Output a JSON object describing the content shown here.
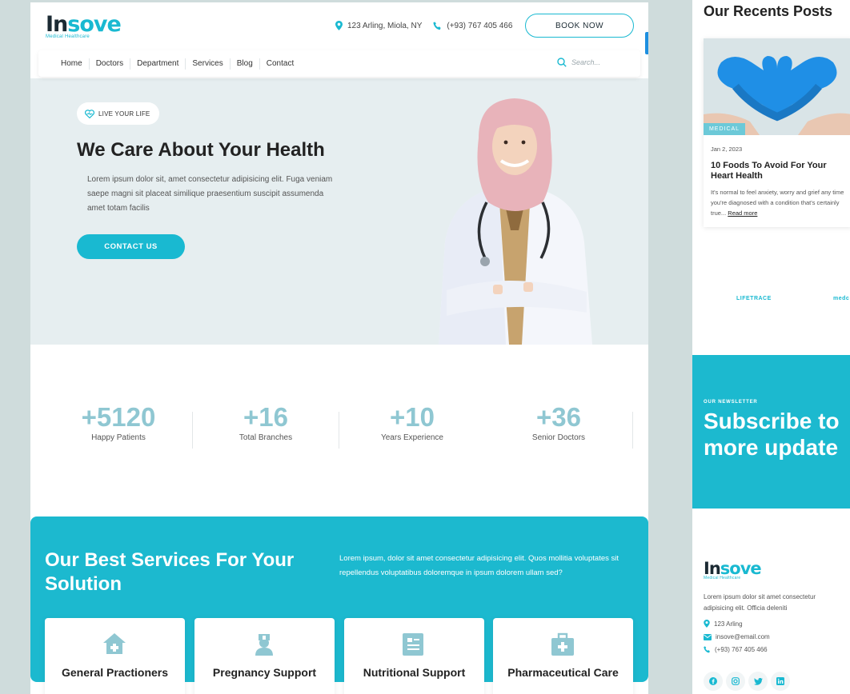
{
  "brand": {
    "name_part1": "In",
    "name_part2": "sove",
    "tagline": "Medical Healthcare",
    "primary_color": "#19b9d1",
    "dark_color": "#1b2a33"
  },
  "header": {
    "address": "123 Arling, Miola, NY",
    "phone": "(+93) 767 405 466",
    "book_label": "BOOK NOW"
  },
  "nav": {
    "items": [
      "Home",
      "Doctors",
      "Department",
      "Services",
      "Blog",
      "Contact"
    ],
    "search_placeholder": "Search..."
  },
  "hero": {
    "badge": "LIVE YOUR LIFE",
    "title": "We Care About Your Health",
    "text": "Lorem ipsum dolor sit, amet consectetur adipisicing elit. Fuga veniam saepe magni sit placeat similique praesentium suscipit assumenda amet totam facilis",
    "cta": "CONTACT US"
  },
  "stats": [
    {
      "value": "+5120",
      "label": "Happy Patients"
    },
    {
      "value": "+16",
      "label": "Total Branches"
    },
    {
      "value": "+10",
      "label": "Years Experience"
    },
    {
      "value": "+36",
      "label": "Senior Doctors"
    }
  ],
  "services": {
    "title": "Our Best Services For Your Solution",
    "text": "Lorem ipsum, dolor sit amet consectetur adipisicing elit. Quos mollitia voluptates sit repellendus voluptatibus doloremque in ipsum dolorem ullam sed?",
    "cards": [
      {
        "name": "General Practioners",
        "icon": "clinic-icon"
      },
      {
        "name": "Pregnancy Support",
        "icon": "nurse-icon"
      },
      {
        "name": "Nutritional Support",
        "icon": "document-icon"
      },
      {
        "name": "Pharmaceutical Care",
        "icon": "medical-kit-icon"
      }
    ]
  },
  "sidebar": {
    "recent_title": "Our Recents Posts",
    "post": {
      "tag": "MEDICAL",
      "date": "Jan 2, 2023",
      "title": "10 Foods To Avoid For Your Heart Health",
      "excerpt": "It's normal to feel anxiety, worry and grief any time you're diagnosed with a condition that's certainly true...",
      "read_more": "Read more"
    },
    "partners": [
      "LIFETRACE",
      "medc"
    ],
    "newsletter": {
      "label": "OUR NEWSLETTER",
      "title_line1": "Subscribe to",
      "title_line2": "more update"
    },
    "footer": {
      "text": "Lorem ipsum dolor sit amet consectetur adipisicing elit. Officia deleniti",
      "address": "123 Arling",
      "email": "insove@email.com",
      "phone": "(+93) 767 405 466",
      "socials": [
        "facebook-icon",
        "instagram-icon",
        "twitter-icon",
        "linkedin-icon"
      ]
    }
  }
}
